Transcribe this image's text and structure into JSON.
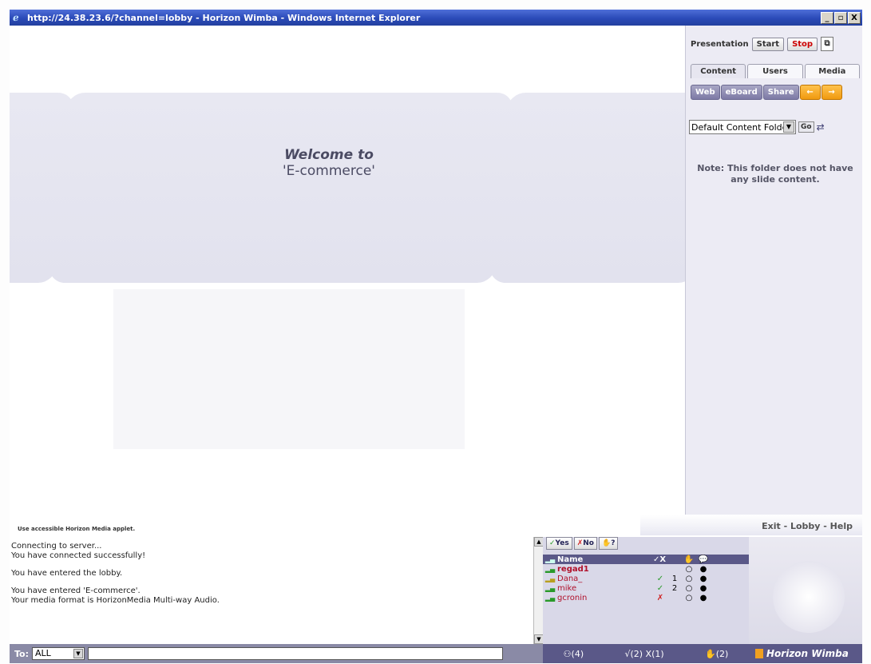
{
  "window": {
    "title": "http://24.38.23.6/?channel=lobby - Horizon Wimba - Windows Internet Explorer",
    "min": "_",
    "max": "▫",
    "close": "X"
  },
  "slide": {
    "welcome_line1": "Welcome to",
    "welcome_line2": "'E-commerce'"
  },
  "presentation": {
    "label": "Presentation",
    "start": "Start",
    "stop": "Stop"
  },
  "tabs": [
    "Content",
    "Users",
    "Media"
  ],
  "tools": [
    "Web",
    "eBoard",
    "Share"
  ],
  "folder": {
    "selected": "Default Content Folder",
    "go": "Go"
  },
  "note": "Note: This folder does not have any slide content.",
  "bottom": {
    "accessible": "Use accessible Horizon Media applet.",
    "footer_links": "Exit - Lobby - Help",
    "chat_lines": [
      "Connecting to server...",
      "You have connected successfully!",
      "You have entered the lobby.",
      "You have entered 'E-commerce'.",
      "Your media format is HorizonMedia Multi-way Audio."
    ],
    "to_label": "To:",
    "to_value": "ALL"
  },
  "votes": {
    "yes": "Yes",
    "no": "No",
    "hand": "?"
  },
  "participants": {
    "header_name": "Name",
    "header_check": "✓X",
    "rows": [
      {
        "name": "regad1",
        "check": "",
        "num": ""
      },
      {
        "name": "Dana_",
        "check": "✓",
        "num": "1"
      },
      {
        "name": "mike",
        "check": "✓",
        "num": "2"
      },
      {
        "name": "gcronin",
        "check": "✗",
        "num": ""
      }
    ],
    "status_users": "(4)",
    "status_votes": "√(2) X(1)",
    "status_hands": "(2)"
  },
  "brand": "Horizon Wimba",
  "colors": {
    "title_bar": "#2a4ab8",
    "panel_bar": "#5a5888",
    "yes": "#2a9a2a",
    "no": "#d02020",
    "arrow_button": "#f09a10"
  }
}
